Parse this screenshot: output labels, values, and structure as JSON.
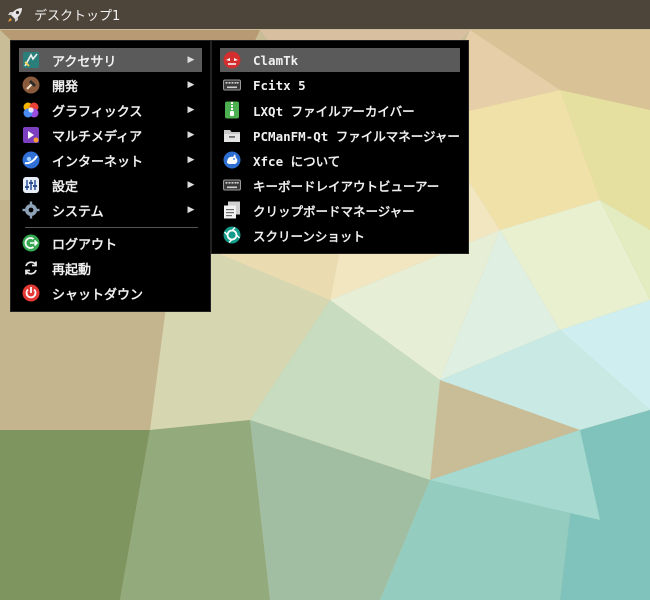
{
  "panel": {
    "title": "デスクトップ1",
    "launcher_icon": "rocket-icon"
  },
  "main_menu": {
    "items": [
      {
        "label": "アクセサリ",
        "icon": "accessories-icon",
        "submenu": true,
        "active": true
      },
      {
        "label": "開発",
        "icon": "hammer-icon",
        "submenu": true
      },
      {
        "label": "グラフィックス",
        "icon": "graphics-icon",
        "submenu": true
      },
      {
        "label": "マルチメディア",
        "icon": "multimedia-icon",
        "submenu": true
      },
      {
        "label": "インターネット",
        "icon": "globe-icon",
        "submenu": true
      },
      {
        "label": "設定",
        "icon": "settings-icon",
        "submenu": true
      },
      {
        "label": "システム",
        "icon": "gear-icon",
        "submenu": true
      }
    ],
    "session": [
      {
        "label": "ログアウト",
        "icon": "logout-icon"
      },
      {
        "label": "再起動",
        "icon": "reboot-icon"
      },
      {
        "label": "シャットダウン",
        "icon": "power-icon"
      }
    ],
    "arrow_glyph": "▶"
  },
  "sub_menu": {
    "items": [
      {
        "label": "ClamTk",
        "icon": "clamtk-icon",
        "active": true
      },
      {
        "label": "Fcitx 5",
        "icon": "keyboard-icon"
      },
      {
        "label": "LXQt ファイルアーカイバー",
        "icon": "archive-icon"
      },
      {
        "label": "PCManFM-Qt ファイルマネージャー",
        "icon": "file-manager-icon"
      },
      {
        "label": "Xfce について",
        "icon": "xfce-icon"
      },
      {
        "label": "キーボードレイアウトビューアー",
        "icon": "keyboard-layout-icon"
      },
      {
        "label": "クリップボードマネージャー",
        "icon": "clipboard-icon"
      },
      {
        "label": "スクリーンショット",
        "icon": "screenshot-icon"
      }
    ]
  },
  "colors": {
    "menu_bg": "#000000",
    "highlight": "#5a5a5a",
    "panel_bg": "#3c342c"
  }
}
